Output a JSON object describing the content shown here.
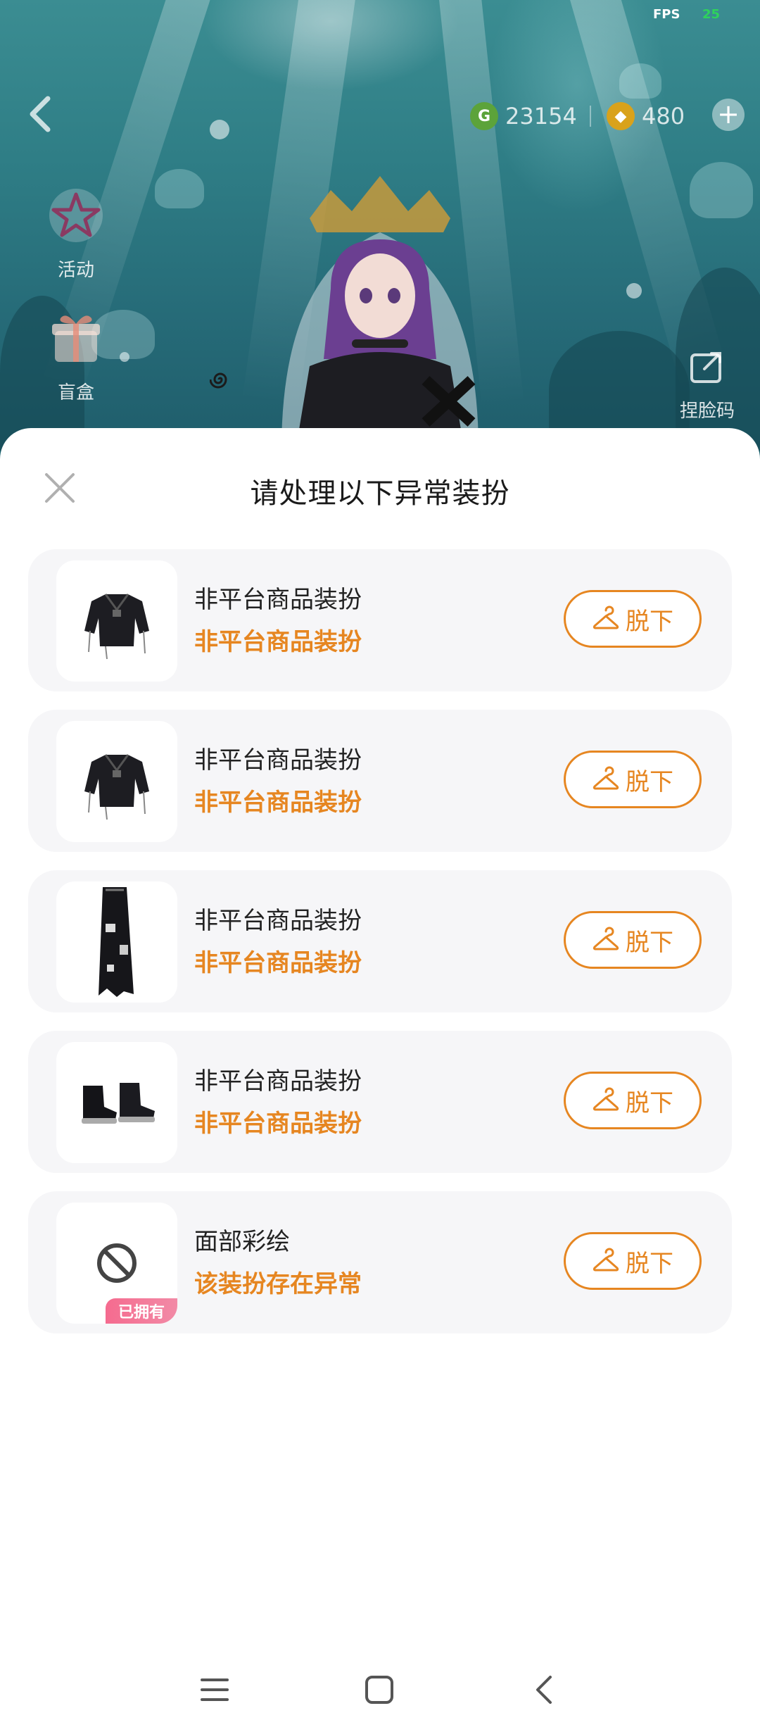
{
  "status": {
    "fps_label": "FPS",
    "fps_value": "25"
  },
  "header": {
    "currency_green": {
      "icon": "g-coin-icon",
      "value": "23154"
    },
    "currency_gold": {
      "icon": "diamond-coin-icon",
      "value": "480"
    }
  },
  "side_menu": {
    "activity_label": "活动",
    "blindbox_label": "盲盒",
    "face_code_label": "捏脸码"
  },
  "dialog": {
    "title": "请处理以下异常装扮",
    "remove_label": "脱下",
    "owned_badge": "已拥有",
    "items": [
      {
        "name": "非平台商品装扮",
        "status": "非平台商品装扮",
        "thumb": "jacket"
      },
      {
        "name": "非平台商品装扮",
        "status": "非平台商品装扮",
        "thumb": "jacket"
      },
      {
        "name": "非平台商品装扮",
        "status": "非平台商品装扮",
        "thumb": "skirt"
      },
      {
        "name": "非平台商品装扮",
        "status": "非平台商品装扮",
        "thumb": "boots"
      },
      {
        "name": "面部彩绘",
        "status": "该装扮存在异常",
        "thumb": "none-icon",
        "owned": true
      }
    ]
  },
  "colors": {
    "accent": "#e68621",
    "badge": "#f56b8f"
  }
}
